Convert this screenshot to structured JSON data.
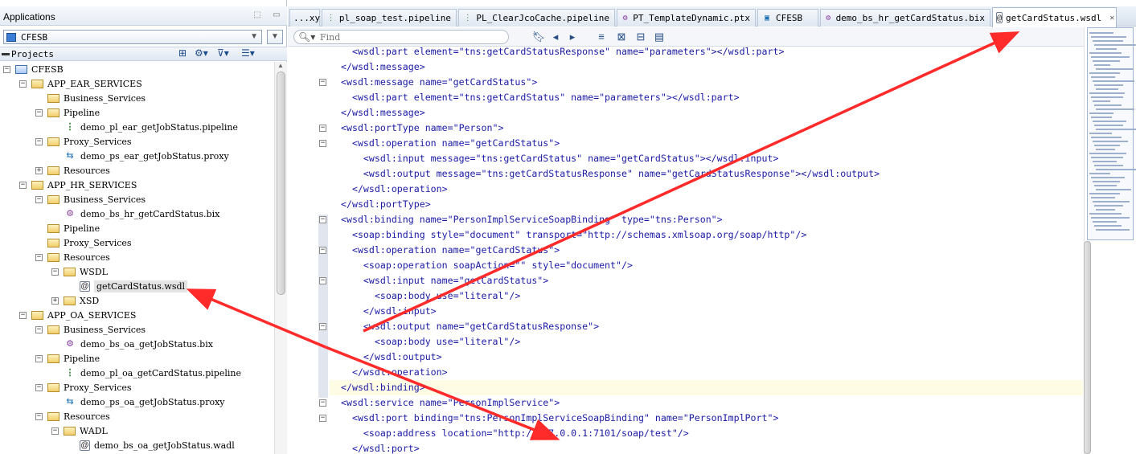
{
  "applications": {
    "title": "Applications",
    "selected_app": "CFESB"
  },
  "projects": {
    "title": "Projects"
  },
  "tree": [
    {
      "label": "CFESB",
      "kind": "project",
      "level": 0,
      "expanded": true
    },
    {
      "label": "APP_EAR_SERVICES",
      "kind": "folder",
      "level": 1,
      "expanded": true
    },
    {
      "label": "Business_Services",
      "kind": "folder",
      "level": 2,
      "expanded": null
    },
    {
      "label": "Pipeline",
      "kind": "folder",
      "level": 2,
      "expanded": true
    },
    {
      "label": "demo_pl_ear_getJobStatus.pipeline",
      "kind": "pipeline",
      "level": 3,
      "expanded": null
    },
    {
      "label": "Proxy_Services",
      "kind": "folder",
      "level": 2,
      "expanded": true
    },
    {
      "label": "demo_ps_ear_getJobStatus.proxy",
      "kind": "proxy",
      "level": 3,
      "expanded": null
    },
    {
      "label": "Resources",
      "kind": "folder",
      "level": 2,
      "expanded": false
    },
    {
      "label": "APP_HR_SERVICES",
      "kind": "folder",
      "level": 1,
      "expanded": true
    },
    {
      "label": "Business_Services",
      "kind": "folder",
      "level": 2,
      "expanded": true
    },
    {
      "label": "demo_bs_hr_getCardStatus.bix",
      "kind": "bix",
      "level": 3,
      "expanded": null
    },
    {
      "label": "Pipeline",
      "kind": "folder",
      "level": 2,
      "expanded": null
    },
    {
      "label": "Proxy_Services",
      "kind": "folder",
      "level": 2,
      "expanded": null
    },
    {
      "label": "Resources",
      "kind": "folder",
      "level": 2,
      "expanded": true
    },
    {
      "label": "WSDL",
      "kind": "folder",
      "level": 3,
      "expanded": true
    },
    {
      "label": "getCardStatus.wsdl",
      "kind": "wsdl",
      "level": 4,
      "expanded": null,
      "selected": true
    },
    {
      "label": "XSD",
      "kind": "folder",
      "level": 3,
      "expanded": false
    },
    {
      "label": "APP_OA_SERVICES",
      "kind": "folder",
      "level": 1,
      "expanded": true
    },
    {
      "label": "Business_Services",
      "kind": "folder",
      "level": 2,
      "expanded": true
    },
    {
      "label": "demo_bs_oa_getJobStatus.bix",
      "kind": "bix",
      "level": 3,
      "expanded": null
    },
    {
      "label": "Pipeline",
      "kind": "folder",
      "level": 2,
      "expanded": true
    },
    {
      "label": "demo_pl_oa_getCardStatus.pipeline",
      "kind": "pipeline",
      "level": 3,
      "expanded": null
    },
    {
      "label": "Proxy_Services",
      "kind": "folder",
      "level": 2,
      "expanded": true
    },
    {
      "label": "demo_ps_oa_getJobStatus.proxy",
      "kind": "proxy",
      "level": 3,
      "expanded": null
    },
    {
      "label": "Resources",
      "kind": "folder",
      "level": 2,
      "expanded": true
    },
    {
      "label": "WADL",
      "kind": "folder",
      "level": 3,
      "expanded": true
    },
    {
      "label": "demo_bs_oa_getJobStatus.wadl",
      "kind": "wsdl",
      "level": 4,
      "expanded": null
    }
  ],
  "tabs": [
    {
      "label": "...xy",
      "icon": "",
      "active": false
    },
    {
      "label": "pl_soap_test.pipeline",
      "icon": "pipeline-icon",
      "active": false
    },
    {
      "label": "PL_ClearJcoCache.pipeline",
      "icon": "pipeline-icon",
      "active": false
    },
    {
      "label": "PT_TemplateDynamic.ptx",
      "icon": "ptx-icon",
      "active": false
    },
    {
      "label": "CFESB",
      "icon": "project-icon",
      "active": false
    },
    {
      "label": "demo_bs_hr_getCardStatus.bix",
      "icon": "bix-icon",
      "active": false
    },
    {
      "label": "getCardStatus.wsdl",
      "icon": "wsdl-icon",
      "active": true
    }
  ],
  "find": {
    "placeholder": "Find"
  },
  "code_lines": [
    {
      "text": "  <wsdl:part element=\"tns:getCardStatusResponse\" name=\"parameters\"></wsdl:part>",
      "fold": ""
    },
    {
      "text": "</wsdl:message>",
      "fold": ""
    },
    {
      "text": "<wsdl:message name=\"getCardStatus\">",
      "fold": "-"
    },
    {
      "text": "  <wsdl:part element=\"tns:getCardStatus\" name=\"parameters\"></wsdl:part>",
      "fold": ""
    },
    {
      "text": "</wsdl:message>",
      "fold": ""
    },
    {
      "text": "<wsdl:portType name=\"Person\">",
      "fold": "-"
    },
    {
      "text": "  <wsdl:operation name=\"getCardStatus\">",
      "fold": "-"
    },
    {
      "text": "    <wsdl:input message=\"tns:getCardStatus\" name=\"getCardStatus\"></wsdl:input>",
      "fold": ""
    },
    {
      "text": "    <wsdl:output message=\"tns:getCardStatusResponse\" name=\"getCardStatusResponse\"></wsdl:output>",
      "fold": ""
    },
    {
      "text": "  </wsdl:operation>",
      "fold": ""
    },
    {
      "text": "</wsdl:portType>",
      "fold": ""
    },
    {
      "text": "<wsdl:binding name=\"PersonImplServiceSoapBinding\" type=\"tns:Person\">",
      "fold": "-"
    },
    {
      "text": "  <soap:binding style=\"document\" transport=\"http://schemas.xmlsoap.org/soap/http\"/>",
      "fold": ""
    },
    {
      "text": "  <wsdl:operation name=\"getCardStatus\">",
      "fold": "-"
    },
    {
      "text": "    <soap:operation soapAction=\"\" style=\"document\"/>",
      "fold": ""
    },
    {
      "text": "    <wsdl:input name=\"getCardStatus\">",
      "fold": "-"
    },
    {
      "text": "      <soap:body use=\"literal\"/>",
      "fold": ""
    },
    {
      "text": "    </wsdl:input>",
      "fold": ""
    },
    {
      "text": "    <wsdl:output name=\"getCardStatusResponse\">",
      "fold": "-"
    },
    {
      "text": "      <soap:body use=\"literal\"/>",
      "fold": ""
    },
    {
      "text": "    </wsdl:output>",
      "fold": ""
    },
    {
      "text": "  </wsdl:operation>",
      "fold": ""
    },
    {
      "text": "</wsdl:binding>",
      "fold": ""
    },
    {
      "text": "<wsdl:service name=\"PersonImplService\">",
      "fold": "-"
    },
    {
      "text": "  <wsdl:port binding=\"tns:PersonImplServiceSoapBinding\" name=\"PersonImplPort\">",
      "fold": "-"
    },
    {
      "text": "    <soap:address location=\"http://127.0.0.1:7101/soap/test\"/>",
      "fold": ""
    },
    {
      "text": "  </wsdl:port>",
      "fold": ""
    }
  ],
  "colors": {
    "annotation_arrow": "#ff2a2a",
    "code_text": "#1a1aa6",
    "current_line": "#fffce6",
    "selection": "#e4e4e4"
  }
}
